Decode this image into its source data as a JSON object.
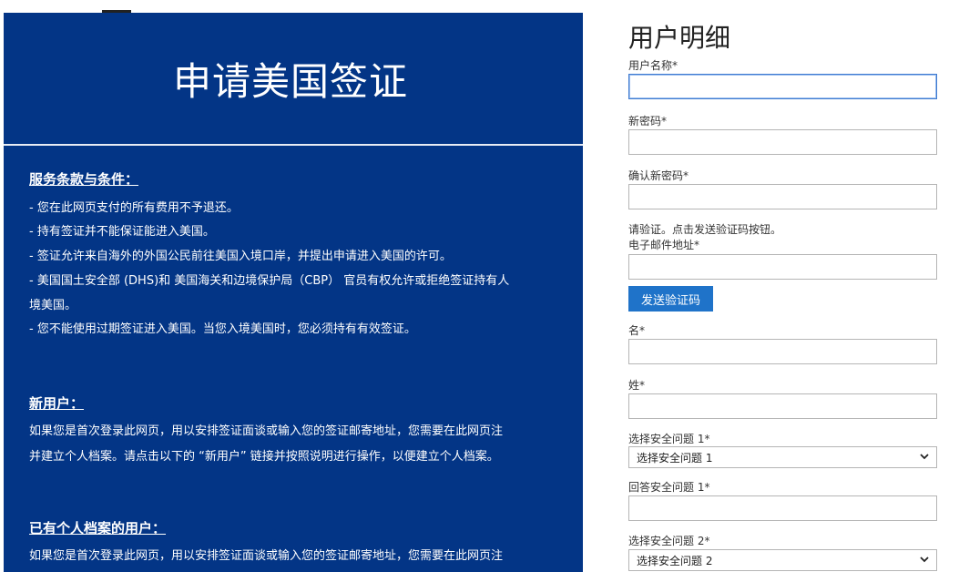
{
  "hero": {
    "title": "申请美国签证"
  },
  "terms": {
    "title": "服务条款与条件：",
    "lines": [
      "- 您在此网页支付的所有费用不予退还。",
      "- 持有签证并不能保证能进入美国。",
      "- 签证允许来自海外的外国公民前往美国入境口岸，并提出申请进入美国的许可。",
      "- 美国国土安全部 (DHS)和 美国海关和边境保护局（CBP） 官员有权允许或拒绝签证持有人",
      "境美国。",
      "- 您不能使用过期签证进入美国。当您入境美国时，您必须持有有效签证。"
    ]
  },
  "new_user": {
    "title": "新用户：",
    "lines": [
      "如果您是首次登录此网页，用以安排签证面谈或输入您的签证邮寄地址，您需要在此网页注",
      "并建立个人档案。请点击以下的 “新用户” 链接并按照说明进行操作，以便建立个人档案。"
    ]
  },
  "existing_user": {
    "title": "已有个人档案的用户：",
    "lines": [
      "如果您是首次登录此网页，用以安排签证面谈或输入您的签证邮寄地址，您需要在此网页注"
    ]
  },
  "form": {
    "title": "用户明细",
    "username_label": "用户名称*",
    "password_label": "新密码*",
    "confirm_label": "确认新密码*",
    "verify_hint": "请验证。点击发送验证码按钮。",
    "email_label": "电子邮件地址*",
    "send_code_button": "发送验证码",
    "first_name_label": "名*",
    "last_name_label": "姓*",
    "q1_label": "选择安全问题 1*",
    "q1_selected": "选择安全问题 1",
    "a1_label": "回答安全问题 1*",
    "q2_label": "选择安全问题 2*",
    "q2_selected": "选择安全问题 2"
  },
  "colors": {
    "hero_bg": "#033586",
    "button_bg": "#1f73c9",
    "focus_border": "#3f7bd1"
  },
  "icons": {
    "select_chevron": "chevron-down-icon"
  }
}
